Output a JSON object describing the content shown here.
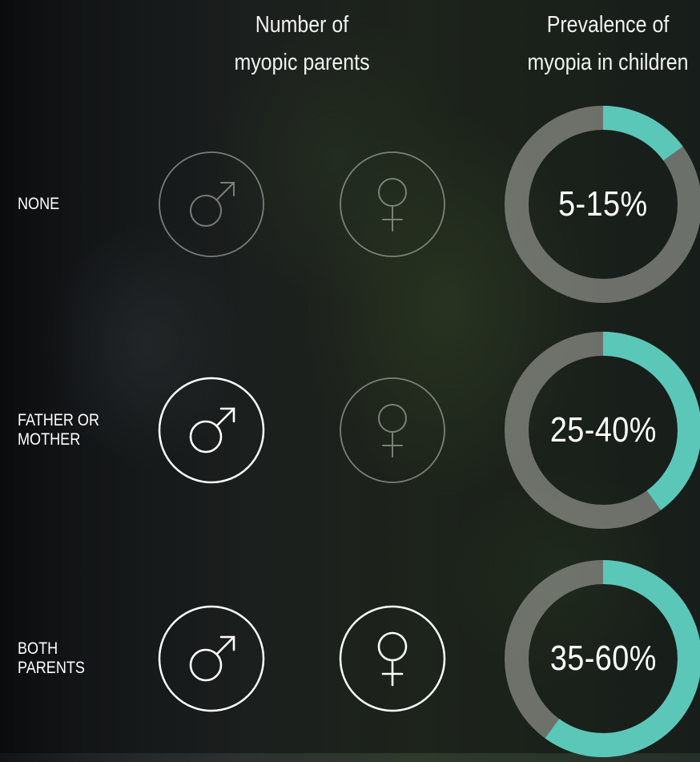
{
  "header": {
    "parents_title": "Number of\nmyopic parents",
    "prevalence_title": "Prevalence of\nmyopia in children"
  },
  "colors": {
    "accent": "#5bc7b8",
    "track": "#8a8c86",
    "icon_active": "#ffffff",
    "icon_inactive": "#9a9d98"
  },
  "icons": {
    "father": "male-symbol-icon",
    "mother": "female-symbol-icon"
  },
  "chart_data": {
    "type": "table",
    "columns": [
      "Number of myopic parents",
      "Prevalence of myopia in children"
    ],
    "rows": [
      {
        "label": "NONE",
        "father_myopic": false,
        "mother_myopic": false,
        "prevalence_text": "5-15%",
        "prevalence_range": [
          5,
          15
        ]
      },
      {
        "label": "FATHER OR\nMOTHER",
        "father_myopic": true,
        "mother_myopic": false,
        "prevalence_text": "25-40%",
        "prevalence_range": [
          25,
          40
        ]
      },
      {
        "label": "BOTH\nPARENTS",
        "father_myopic": true,
        "mother_myopic": true,
        "prevalence_text": "35-60%",
        "prevalence_range": [
          35,
          60
        ]
      }
    ]
  }
}
